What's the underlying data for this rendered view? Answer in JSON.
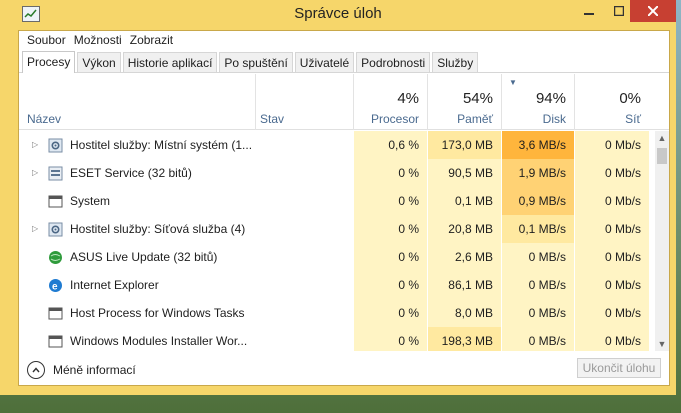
{
  "window": {
    "title": "Správce úloh"
  },
  "menu": [
    "Soubor",
    "Možnosti",
    "Zobrazit"
  ],
  "tabs": [
    "Procesy",
    "Výkon",
    "Historie aplikací",
    "Po spuštění",
    "Uživatelé",
    "Podrobnosti",
    "Služby"
  ],
  "active_tab": "Procesy",
  "columns": {
    "name": "Název",
    "status": "Stav",
    "cpu": {
      "pct": "4%",
      "label": "Procesor"
    },
    "mem": {
      "pct": "54%",
      "label": "Paměť"
    },
    "disk": {
      "pct": "94%",
      "label": "Disk"
    },
    "net": {
      "pct": "0%",
      "label": "Síť"
    }
  },
  "processes": [
    {
      "name": "Hostitel služby: Místní systém (1...",
      "icon": "gear-icon",
      "expandable": true,
      "cpu": "0,6 %",
      "mem": "173,0 MB",
      "disk": "3,6 MB/s",
      "net": "0 Mb/s"
    },
    {
      "name": "ESET Service (32 bitů)",
      "icon": "service-icon",
      "expandable": true,
      "cpu": "0 %",
      "mem": "90,5 MB",
      "disk": "1,9 MB/s",
      "net": "0 Mb/s"
    },
    {
      "name": "System",
      "icon": "window-icon",
      "expandable": false,
      "cpu": "0 %",
      "mem": "0,1 MB",
      "disk": "0,9 MB/s",
      "net": "0 Mb/s"
    },
    {
      "name": "Hostitel služby: Síťová služba (4)",
      "icon": "gear-icon",
      "expandable": true,
      "cpu": "0 %",
      "mem": "20,8 MB",
      "disk": "0,1 MB/s",
      "net": "0 Mb/s"
    },
    {
      "name": "ASUS Live Update (32 bitů)",
      "icon": "globe-icon",
      "expandable": false,
      "cpu": "0 %",
      "mem": "2,6 MB",
      "disk": "0 MB/s",
      "net": "0 Mb/s"
    },
    {
      "name": "Internet Explorer",
      "icon": "ie-icon",
      "expandable": false,
      "cpu": "0 %",
      "mem": "86,1 MB",
      "disk": "0 MB/s",
      "net": "0 Mb/s"
    },
    {
      "name": "Host Process for Windows Tasks",
      "icon": "window-icon",
      "expandable": false,
      "cpu": "0 %",
      "mem": "8,0 MB",
      "disk": "0 MB/s",
      "net": "0 Mb/s"
    },
    {
      "name": "Windows Modules Installer Wor...",
      "icon": "window-icon",
      "expandable": false,
      "cpu": "0 %",
      "mem": "198,3 MB",
      "disk": "0 MB/s",
      "net": "0 Mb/s"
    }
  ],
  "footer": {
    "less_info": "Méně informací",
    "end_task": "Ukončit úlohu"
  },
  "colors": {
    "window_frame": "#f6d66a",
    "cell_light": "#fff4c4",
    "cell_mid": "#ffe9a0",
    "cell_strong": "#ffd274",
    "cell_hot": "#ffb53c"
  }
}
